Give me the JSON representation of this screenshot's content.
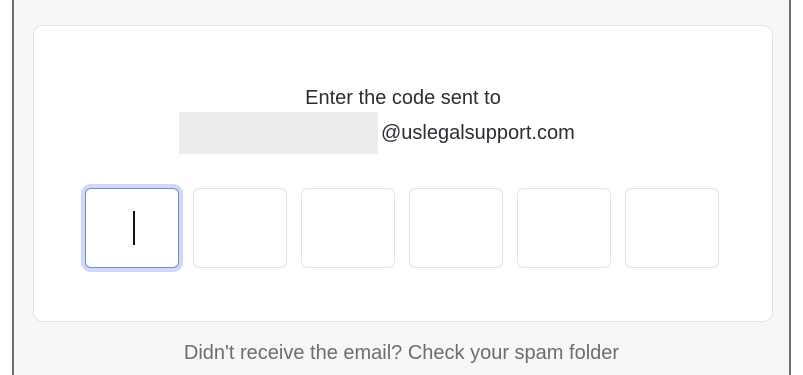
{
  "verification": {
    "prompt": "Enter the code sent to",
    "email_domain": "@uslegalsupport.com",
    "code_digits": [
      "",
      "",
      "",
      "",
      "",
      ""
    ],
    "active_index": 0,
    "help_text": "Didn't receive the email? Check your spam folder"
  }
}
